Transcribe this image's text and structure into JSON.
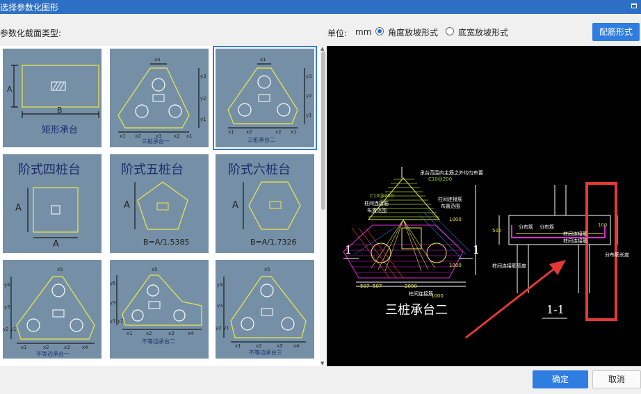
{
  "window": {
    "title": "选择参数化图形"
  },
  "header": {
    "section_label": "参数化截面类型:",
    "unit_label": "单位:",
    "unit_value": "mm",
    "radio_angle_label": "角度放坡形式",
    "radio_width_label": "底宽放坡形式",
    "rebar_button": "配筋形式"
  },
  "thumbnails": [
    {
      "caption": "矩形承台",
      "dims": [
        "A",
        "B"
      ]
    },
    {
      "caption": "三桩承台一",
      "dims": [
        "x4",
        "y3",
        "y2",
        "y1",
        "x1",
        "x2",
        "x3",
        "x2",
        "x1"
      ]
    },
    {
      "caption": "三桩承台二",
      "dims": [
        "x1",
        "y3",
        "y2",
        "y1",
        "x1",
        "x2",
        "x2",
        "x1"
      ]
    },
    {
      "title": "阶式四桩台",
      "dims": [
        "A",
        "A"
      ]
    },
    {
      "title": "阶式五桩台",
      "dims": [
        "A"
      ],
      "formula": "B=A/1.5385"
    },
    {
      "title": "阶式六桩台",
      "dims": [
        "A"
      ],
      "formula": "B=A/1.7326"
    },
    {
      "caption": "不等边承台一",
      "dims": [
        "x5",
        "y4",
        "y3",
        "y2 y1",
        "x1",
        "x2",
        "x3",
        "x4"
      ]
    },
    {
      "caption": "不等边承台二",
      "dims": [
        "x5",
        "y5",
        "y3",
        "y1 y2",
        "x1",
        "x2",
        "x3",
        "x4"
      ]
    },
    {
      "caption": "不等边承台三",
      "dims": [
        "x5",
        "y4",
        "y3",
        "y2 y1",
        "x1",
        "x2",
        "x3",
        "x4"
      ]
    }
  ],
  "preview": {
    "title": "三桩承台二",
    "section_label": "1-1",
    "left_section_marker": "1",
    "right_section_marker": "1",
    "note_top": "承台范围内主筋之外均匀布置",
    "spec_top": "C10@200",
    "label_col_rebar": "柱间连接筋",
    "label_range": "布置范围",
    "label_col_rebar2": "柱间连接筋",
    "label_range2": "布置范围",
    "spec_a": "C10@200",
    "value_1000a": "1000",
    "value_1000b": "1000",
    "value_1000c": "1000",
    "value_507a": "507",
    "value_507b": "507",
    "value_2000": "2000",
    "value_500": "500",
    "value_100": "100",
    "label_dist_a": "分布筋",
    "label_dist_b": "分布筋",
    "label_lap": "柱间连接筋",
    "label_lap2": "柱间连接筋",
    "label_rebar_vert": "分布筋长度",
    "label_side_vert": "柱间连接筋高度",
    "label_bottom": "柱间连接筋"
  },
  "footer": {
    "ok": "确定",
    "cancel": "取消"
  },
  "colors": {
    "accent": "#2f7de1",
    "title_bar": "#2d6fc4",
    "thumb_bg": "#7590a6",
    "annotation": "#e53935"
  }
}
